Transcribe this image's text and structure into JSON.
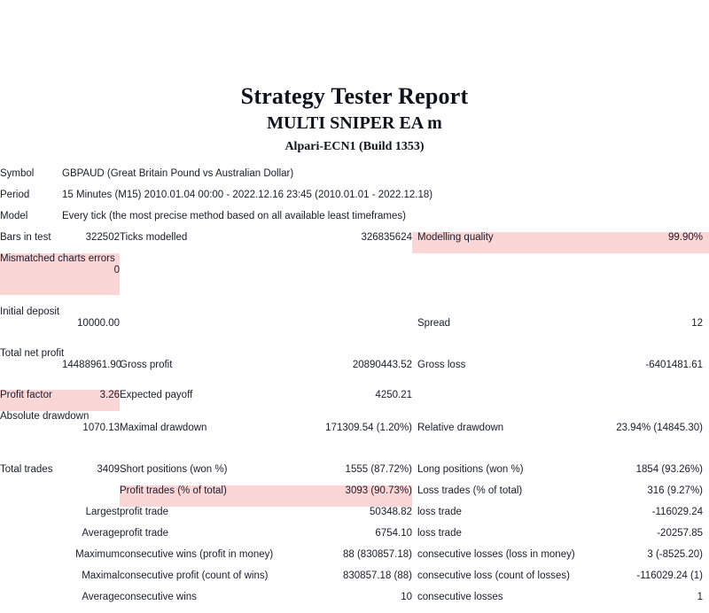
{
  "report": {
    "title": "Strategy Tester Report",
    "subtitle": "MULTI SNIPER EA m",
    "build": "Alpari-ECN1 (Build 1353)",
    "highlight_color": "#fbd6d6",
    "rows": {
      "symbol_label": "Symbol",
      "symbol_value": "GBPAUD (Great Britain Pound vs Australian Dollar)",
      "period_label": "Period",
      "period_value": "15 Minutes (M15) 2010.01.04 00:00 - 2022.12.16 23:45 (2010.01.01 - 2022.12.18)",
      "model_label": "Model",
      "model_value": "Every tick (the most precise method based on all available least timeframes)",
      "bars_in_test_label": "Bars in test",
      "bars_in_test_value": "322502",
      "ticks_modelled_label": "Ticks modelled",
      "ticks_modelled_value": "326835624",
      "modelling_quality_label": "Modelling quality",
      "modelling_quality_value": "99.90%",
      "mismatched_label": "Mismatched charts errors",
      "mismatched_value": "0",
      "initial_deposit_label": "Initial deposit",
      "initial_deposit_value": "10000.00",
      "spread_label": "Spread",
      "spread_value": "12",
      "total_net_profit_label": "Total net profit",
      "total_net_profit_value": "14488961.90",
      "gross_profit_label": "Gross profit",
      "gross_profit_value": "20890443.52",
      "gross_loss_label": "Gross loss",
      "gross_loss_value": "-6401481.61",
      "profit_factor_label": "Profit factor",
      "profit_factor_value": "3.26",
      "expected_payoff_label": "Expected payoff",
      "expected_payoff_value": "4250.21",
      "absolute_drawdown_label": "Absolute drawdown",
      "absolute_drawdown_value": "1070.13",
      "maximal_drawdown_label": "Maximal drawdown",
      "maximal_drawdown_value": "171309.54 (1.20%)",
      "relative_drawdown_label": "Relative drawdown",
      "relative_drawdown_value": "23.94% (14845.30)",
      "total_trades_label": "Total trades",
      "total_trades_value": "3409",
      "short_positions_label": "Short positions (won %)",
      "short_positions_value": "1555 (87.72%)",
      "long_positions_label": "Long positions (won %)",
      "long_positions_value": "1854 (93.26%)",
      "profit_trades_label": "Profit trades (% of total)",
      "profit_trades_value": "3093 (90.73%)",
      "loss_trades_label": "Loss trades (% of total)",
      "loss_trades_value": "316 (9.27%)",
      "largest_label": "Largest",
      "largest_profit_trade_label": "profit trade",
      "largest_profit_trade_value": "50348.82",
      "largest_loss_trade_label": "loss trade",
      "largest_loss_trade_value": "-116029.24",
      "average_label": "Average",
      "average_profit_trade_label": "profit trade",
      "average_profit_trade_value": "6754.10",
      "average_loss_trade_label": "loss trade",
      "average_loss_trade_value": "-20257.85",
      "maximum_label": "Maximum",
      "max_consecutive_wins_label": "consecutive wins (profit in money)",
      "max_consecutive_wins_value": "88 (830857.18)",
      "max_consecutive_losses_label": "consecutive losses (loss in money)",
      "max_consecutive_losses_value": "3 (-8525.20)",
      "maximal_label": "Maximal",
      "maximal_consecutive_profit_label": "consecutive profit (count of wins)",
      "maximal_consecutive_profit_value": "830857.18 (88)",
      "maximal_consecutive_loss_label": "consecutive loss (count of losses)",
      "maximal_consecutive_loss_value": "-116029.24 (1)",
      "average2_label": "Average",
      "avg_consecutive_wins_label": "consecutive wins",
      "avg_consecutive_wins_value": "10",
      "avg_consecutive_losses_label": "consecutive losses",
      "avg_consecutive_losses_value": "1"
    }
  }
}
